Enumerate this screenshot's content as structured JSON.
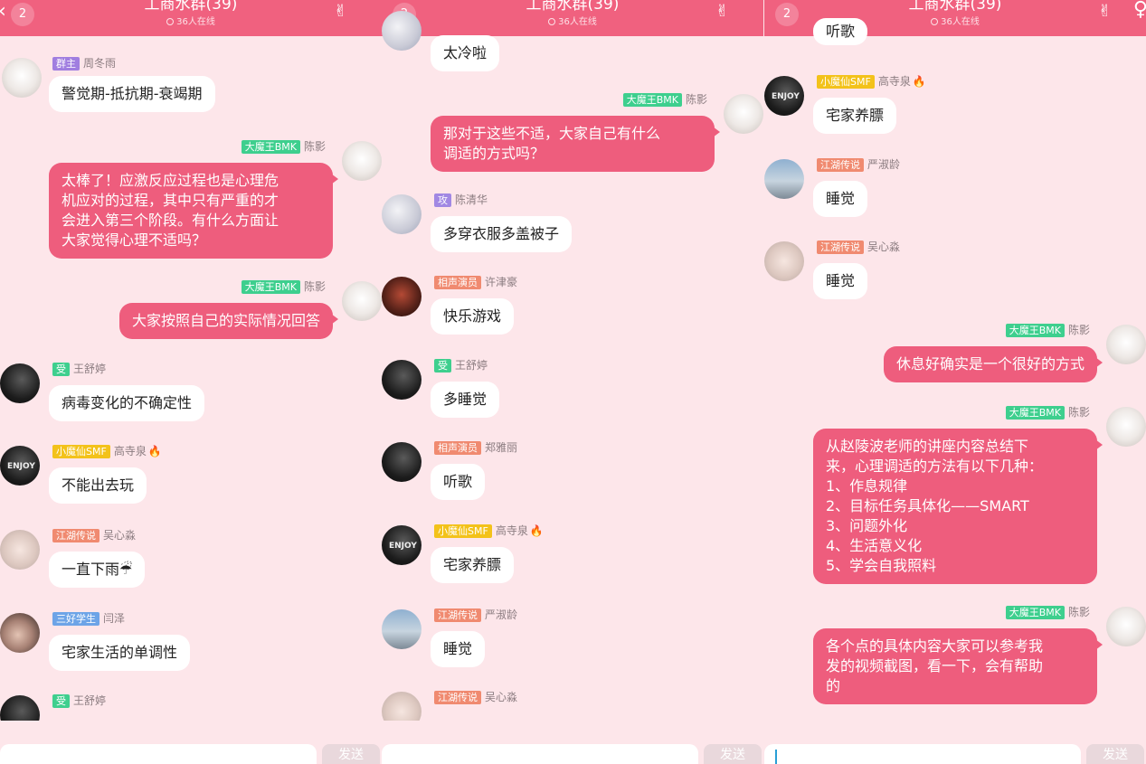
{
  "header": {
    "badge": "2",
    "title": "工商水群(39)",
    "online": "36人在线"
  },
  "panels": [
    {
      "messages": [
        {
          "tag": "群主",
          "name": "周冬雨",
          "text": "警觉期-抵抗期-衰竭期"
        },
        {
          "tag": "大魔王BMK",
          "name": "陈影",
          "text": "太棒了！应激反应过程也是心理危\n机应对的过程，其中只有严重的才\n会进入第三个阶段。有什么方面让\n大家觉得心理不适吗？"
        },
        {
          "tag": "大魔王BMK",
          "name": "陈影",
          "text": "大家按照自己的实际情况回答"
        },
        {
          "tag": "受",
          "name": "王舒婷",
          "text": "病毒变化的不确定性"
        },
        {
          "tag": "小魔仙SMF",
          "name": "高寺泉",
          "text": "不能出去玩"
        },
        {
          "tag": "江湖传说",
          "name": "吴心淼",
          "text": "一直下雨☔"
        },
        {
          "tag": "三好学生",
          "name": "闫泽",
          "text": "宅家生活的单调性"
        },
        {
          "tag": "受",
          "name": "王舒婷",
          "text": ""
        }
      ],
      "send": "发送"
    },
    {
      "messages": [
        {
          "tag": "",
          "name": "",
          "text": "太冷啦"
        },
        {
          "tag": "大魔王BMK",
          "name": "陈影",
          "text": "那对于这些不适，大家自己有什么\n调适的方式吗？"
        },
        {
          "tag": "攻",
          "name": "陈清华",
          "text": "多穿衣服多盖被子"
        },
        {
          "tag": "相声演员",
          "name": "许津豪",
          "text": "快乐游戏"
        },
        {
          "tag": "受",
          "name": "王舒婷",
          "text": "多睡觉"
        },
        {
          "tag": "相声演员",
          "name": "郑雅丽",
          "text": "听歌"
        },
        {
          "tag": "小魔仙SMF",
          "name": "高寺泉",
          "text": "宅家养膘"
        },
        {
          "tag": "江湖传说",
          "name": "严淑龄",
          "text": "睡觉"
        },
        {
          "tag": "江湖传说",
          "name": "吴心淼",
          "text": ""
        }
      ],
      "send": "发送"
    },
    {
      "messages": [
        {
          "tag": "",
          "name": "",
          "text": "听歌"
        },
        {
          "tag": "小魔仙SMF",
          "name": "高寺泉",
          "text": "宅家养膘"
        },
        {
          "tag": "江湖传说",
          "name": "严淑龄",
          "text": "睡觉"
        },
        {
          "tag": "江湖传说",
          "name": "吴心淼",
          "text": "睡觉"
        },
        {
          "tag": "大魔王BMK",
          "name": "陈影",
          "text": "休息好确实是一个很好的方式"
        },
        {
          "tag": "大魔王BMK",
          "name": "陈影",
          "text": "从赵陵波老师的讲座内容总结下\n来，心理调适的方法有以下几种：\n1、作息规律\n2、目标任务具体化——SMART\n3、问题外化\n4、生活意义化\n5、学会自我照料"
        },
        {
          "tag": "大魔王BMK",
          "name": "陈影",
          "text": "各个点的具体内容大家可以参考我\n发的视频截图，看一下，会有帮助\n的"
        }
      ],
      "send": "发送"
    }
  ],
  "colors": {
    "header": "#f0617f",
    "background": "#fde6ea",
    "bubble_self": "#ee5d7d",
    "bubble_other": "#ffffff"
  }
}
